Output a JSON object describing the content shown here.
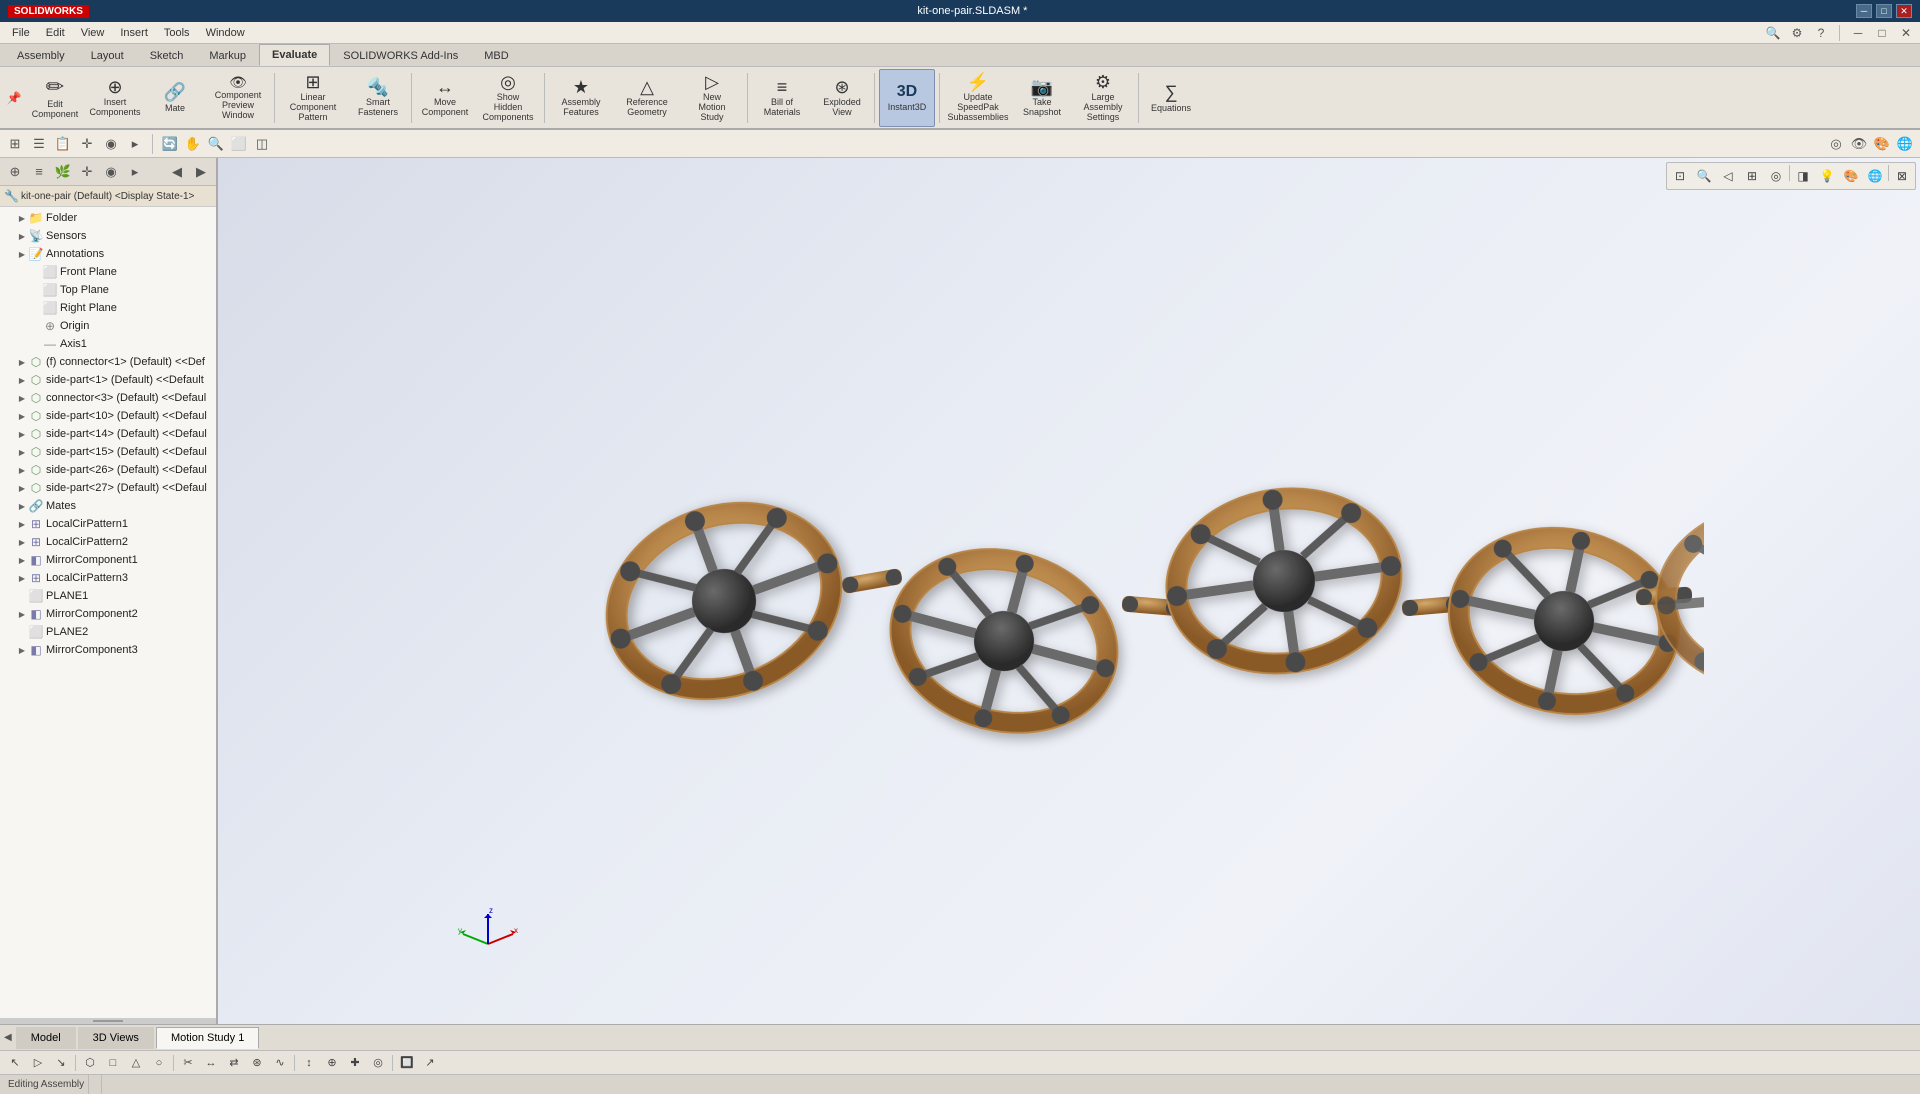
{
  "titlebar": {
    "title": "kit-one-pair.SLDASM *",
    "logo": "SOLIDWORKS",
    "controls": [
      "─",
      "□",
      "✕"
    ]
  },
  "menubar": {
    "items": [
      "File",
      "Edit",
      "View",
      "Insert",
      "Tools",
      "Window"
    ],
    "right_icons": [
      "🔍",
      "⚙",
      "?",
      "─",
      "□",
      "✕"
    ]
  },
  "ribbon": {
    "active_tab": "Assembly",
    "tabs": [
      "Assembly",
      "Layout",
      "Sketch",
      "Markup",
      "Evaluate",
      "SOLIDWORKS Add-Ins",
      "MBD"
    ],
    "buttons": [
      {
        "id": "edit-component",
        "icon": "✏",
        "label": "Edit\nComponent",
        "active": false
      },
      {
        "id": "insert-components",
        "icon": "⊕",
        "label": "Insert\nComponents",
        "active": false
      },
      {
        "id": "mate",
        "icon": "🔗",
        "label": "Mate",
        "active": false
      },
      {
        "id": "component-preview",
        "icon": "👁",
        "label": "Component\nPreview\nWindow",
        "active": false
      },
      {
        "id": "linear-component-pattern",
        "icon": "⊞",
        "label": "Linear Component\nPattern",
        "active": false
      },
      {
        "id": "smart-fasteners",
        "icon": "🔩",
        "label": "Smart\nFasteners",
        "active": false
      },
      {
        "id": "move-component",
        "icon": "↔",
        "label": "Move\nComponent",
        "active": false
      },
      {
        "id": "show-hidden-components",
        "icon": "◎",
        "label": "Show\nHidden\nComponents",
        "active": false
      },
      {
        "id": "assembly-features",
        "icon": "★",
        "label": "Assembly\nFeatures",
        "active": false
      },
      {
        "id": "reference-geometry",
        "icon": "△",
        "label": "Reference\nGeometry",
        "active": false
      },
      {
        "id": "new-motion-study",
        "icon": "▷",
        "label": "New\nMotion\nStudy",
        "active": false
      },
      {
        "id": "bill-of-materials",
        "icon": "≡",
        "label": "Bill of\nMaterials",
        "active": false
      },
      {
        "id": "exploded-view",
        "icon": "⊛",
        "label": "Exploded\nView",
        "active": false
      },
      {
        "id": "instant3d",
        "icon": "3D",
        "label": "Instant3D",
        "active": true
      },
      {
        "id": "update-speedpak",
        "icon": "⚡",
        "label": "Update\nSpeedPak\nSubassemblies",
        "active": false
      },
      {
        "id": "take-snapshot",
        "icon": "📷",
        "label": "Take\nSnapshot",
        "active": false
      },
      {
        "id": "large-assembly-settings",
        "icon": "⚙",
        "label": "Large\nAssembly\nSettings",
        "active": false
      },
      {
        "id": "equations",
        "icon": "∑",
        "label": "Equations",
        "active": false
      }
    ]
  },
  "commandbar": {
    "tabs": [
      "Assembly",
      "Layout",
      "Sketch",
      "Markup",
      "Evaluate",
      "SOLIDWORKS Add-Ins",
      "MBD"
    ]
  },
  "leftpanel": {
    "toolbar_icons": [
      "⊕",
      "≡",
      "🌿",
      "✛",
      "◉",
      "▸"
    ],
    "tree": {
      "root": "kit-one-pair (Default) <Display State-1>",
      "items": [
        {
          "id": "folder",
          "label": "Folder",
          "icon": "📁",
          "indent": 1,
          "expandable": true
        },
        {
          "id": "sensors",
          "label": "Sensors",
          "icon": "📡",
          "indent": 1,
          "expandable": true
        },
        {
          "id": "annotations",
          "label": "Annotations",
          "icon": "📝",
          "indent": 1,
          "expandable": true
        },
        {
          "id": "front-plane",
          "label": "Front Plane",
          "icon": "⬜",
          "indent": 2,
          "expandable": false
        },
        {
          "id": "top-plane",
          "label": "Top Plane",
          "icon": "⬜",
          "indent": 2,
          "expandable": false
        },
        {
          "id": "right-plane",
          "label": "Right Plane",
          "icon": "⬜",
          "indent": 2,
          "expandable": false
        },
        {
          "id": "origin",
          "label": "Origin",
          "icon": "⊕",
          "indent": 2,
          "expandable": false
        },
        {
          "id": "axis1",
          "label": "Axis1",
          "icon": "—",
          "indent": 2,
          "expandable": false
        },
        {
          "id": "connector1",
          "label": "(f) connector<1> (Default) <<Def",
          "icon": "🔩",
          "indent": 1,
          "expandable": true
        },
        {
          "id": "side-part1",
          "label": "side-part<1> (Default) <<Default",
          "icon": "🔩",
          "indent": 1,
          "expandable": true
        },
        {
          "id": "connector3",
          "label": "connector<3> (Default) <<Defaul",
          "icon": "🔩",
          "indent": 1,
          "expandable": true
        },
        {
          "id": "side-part10",
          "label": "side-part<10> (Default) <<Defaul",
          "icon": "🔩",
          "indent": 1,
          "expandable": true
        },
        {
          "id": "side-part14",
          "label": "side-part<14> (Default) <<Defaul",
          "icon": "🔩",
          "indent": 1,
          "expandable": true
        },
        {
          "id": "side-part15",
          "label": "side-part<15> (Default) <<Defaul",
          "icon": "🔩",
          "indent": 1,
          "expandable": true
        },
        {
          "id": "side-part26",
          "label": "side-part<26> (Default) <<Defaul",
          "icon": "🔩",
          "indent": 1,
          "expandable": true
        },
        {
          "id": "side-part27",
          "label": "side-part<27> (Default) <<Defaul",
          "icon": "🔩",
          "indent": 1,
          "expandable": true
        },
        {
          "id": "mates",
          "label": "Mates",
          "icon": "🔗",
          "indent": 1,
          "expandable": true
        },
        {
          "id": "localcirpattern1",
          "label": "LocalCirPattern1",
          "icon": "⊞",
          "indent": 1,
          "expandable": true
        },
        {
          "id": "localcirpattern2",
          "label": "LocalCirPattern2",
          "icon": "⊞",
          "indent": 1,
          "expandable": true
        },
        {
          "id": "mirrorcomponent1",
          "label": "MirrorComponent1",
          "icon": "◧",
          "indent": 1,
          "expandable": true
        },
        {
          "id": "localcirpattern3",
          "label": "LocalCirPattern3",
          "icon": "⊞",
          "indent": 1,
          "expandable": true
        },
        {
          "id": "plane1",
          "label": "PLANE1",
          "icon": "⬜",
          "indent": 1,
          "expandable": false
        },
        {
          "id": "mirrorcomponent2",
          "label": "MirrorComponent2",
          "icon": "◧",
          "indent": 1,
          "expandable": true
        },
        {
          "id": "plane2",
          "label": "PLANE2",
          "icon": "⬜",
          "indent": 1,
          "expandable": false
        },
        {
          "id": "mirrorcomponent3",
          "label": "MirrorComponent3",
          "icon": "◧",
          "indent": 1,
          "expandable": true
        }
      ]
    }
  },
  "viewport": {
    "bg_color_start": "#d8dce8",
    "bg_color_end": "#f0f2f8"
  },
  "bottomtabs": {
    "tabs": [
      {
        "id": "model",
        "label": "Model",
        "active": false
      },
      {
        "id": "3d-views",
        "label": "3D Views",
        "active": false
      },
      {
        "id": "motion-study-1",
        "label": "Motion Study 1",
        "active": true
      }
    ]
  },
  "statusbar": {
    "text": "",
    "mode": "Editing Assembly"
  },
  "bottomtoolbar": {
    "icons": [
      "↖",
      "▷",
      "↘",
      "⬡",
      "□",
      "△",
      "⊕",
      "⊞",
      "◎",
      "✂",
      "↔",
      "⇄",
      "⊛",
      "∿",
      "↕",
      "⊕",
      "✚",
      "◎",
      "🔲",
      "↗",
      "⊠",
      "⊡",
      "⊟",
      "⊢",
      "⊣",
      "∥"
    ]
  },
  "colors": {
    "accent": "#1a3a5c",
    "bg_ribbon": "#e8e4dc",
    "bg_panel": "#f0ece4",
    "bg_tree": "#f8f6f2",
    "selected": "#b8d0e8",
    "hover": "#d8e8f8",
    "separator": "#aaaaaa",
    "model_tan": "#c8a870",
    "model_dark": "#4a4a4a"
  }
}
